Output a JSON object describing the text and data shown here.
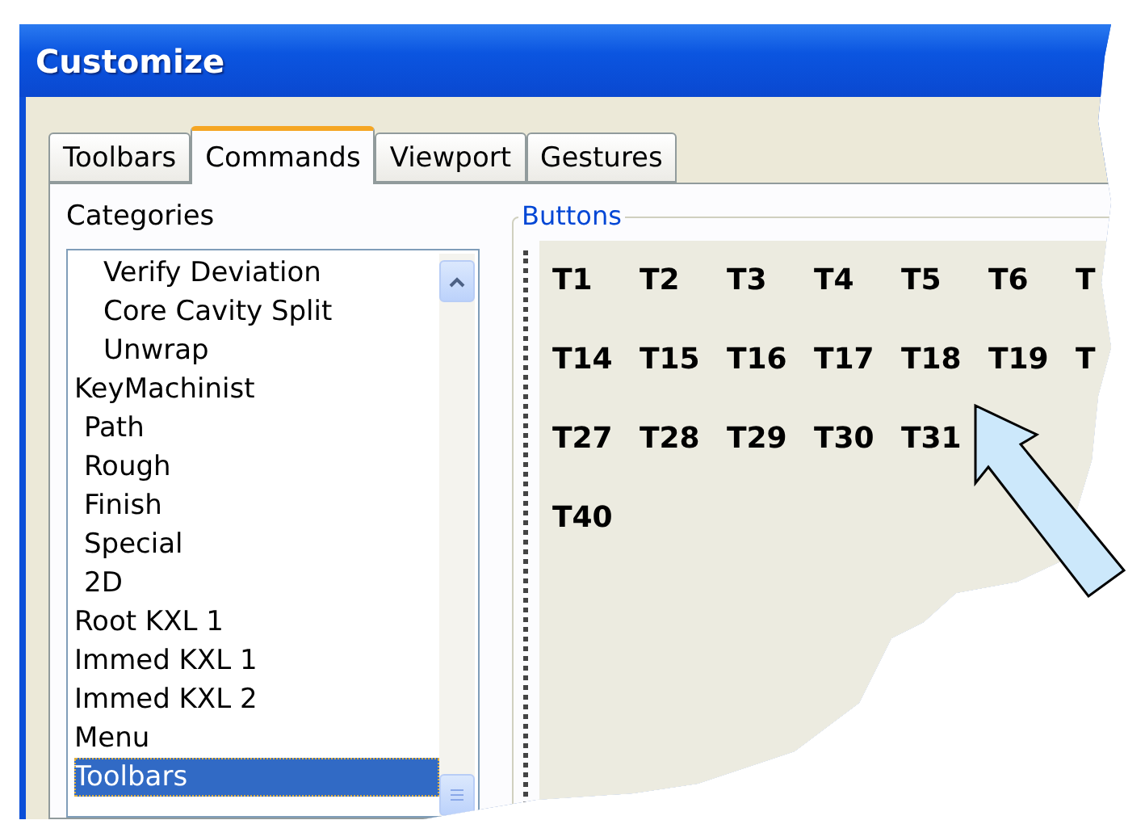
{
  "window": {
    "title": "Customize"
  },
  "tabs": [
    {
      "label": "Toolbars",
      "selected": false
    },
    {
      "label": "Commands",
      "selected": true
    },
    {
      "label": "Viewport",
      "selected": false
    },
    {
      "label": "Gestures",
      "selected": false
    }
  ],
  "categories": {
    "label": "Categories",
    "items": [
      {
        "label": "Verify Deviation",
        "kind": "continued",
        "selected": false
      },
      {
        "label": "Core Cavity Split",
        "kind": "continued",
        "selected": false
      },
      {
        "label": "Unwrap",
        "kind": "continued",
        "selected": false
      },
      {
        "label": "KeyMachinist",
        "kind": "group",
        "selected": false,
        "children": [
          {
            "label": "Path",
            "kind": "child",
            "selected": false
          },
          {
            "label": "Rough",
            "kind": "child",
            "selected": false
          },
          {
            "label": "Finish",
            "kind": "child",
            "selected": false
          },
          {
            "label": "Special",
            "kind": "child",
            "selected": false
          },
          {
            "label": "2D",
            "kind": "child",
            "selected": false
          }
        ]
      },
      {
        "label": "Root KXL 1",
        "kind": "group",
        "selected": false
      },
      {
        "label": "Immed KXL 1",
        "kind": "group",
        "selected": false
      },
      {
        "label": "Immed KXL 2",
        "kind": "group",
        "selected": false
      },
      {
        "label": "Menu",
        "kind": "group",
        "selected": false
      },
      {
        "label": "Toolbars",
        "kind": "group",
        "selected": true
      }
    ]
  },
  "buttons": {
    "label": "Buttons",
    "rows": [
      [
        "T1",
        "T2",
        "T3",
        "T4",
        "T5",
        "T6",
        "T"
      ],
      [
        "T14",
        "T15",
        "T16",
        "T17",
        "T18",
        "T19",
        "T"
      ],
      [
        "T27",
        "T28",
        "T29",
        "T30",
        "T31"
      ],
      [
        "T40"
      ]
    ]
  }
}
